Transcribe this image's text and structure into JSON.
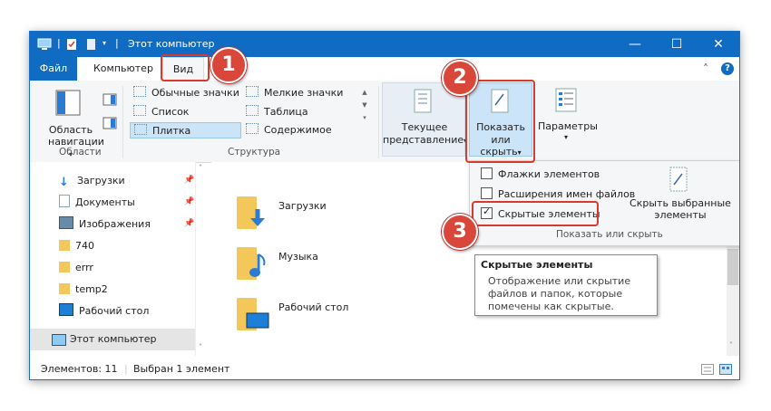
{
  "window": {
    "title": "Этот компьютер",
    "controls": {
      "minimize": "—",
      "maximize": "☐",
      "close": "✕"
    }
  },
  "menu": {
    "file": "Файл",
    "computer": "Компьютер",
    "view": "Вид",
    "collapse": "˄",
    "help": "?"
  },
  "ribbon": {
    "panes": {
      "nav_pane_label1": "Область",
      "nav_pane_label2": "навигации",
      "group": "Области"
    },
    "layout": {
      "group": "Структура",
      "items": [
        "Обычные значки",
        "Мелкие значки",
        "Список",
        "Таблица",
        "Плитка",
        "Содержимое"
      ]
    },
    "current_view": {
      "line1": "Текущее",
      "line2": "представление"
    },
    "show_hide": {
      "line1": "Показать",
      "line2": "или скрыть"
    },
    "options": "Параметры"
  },
  "dropdown": {
    "item_checkboxes": "Флажки элементов",
    "file_extensions": "Расширения имен файлов",
    "hidden_items": "Скрытые элементы",
    "hide_selected1": "Скрыть выбранные",
    "hide_selected2": "элементы",
    "group": "Показать или скрыть"
  },
  "tooltip": {
    "title": "Скрытые элементы",
    "line1": "Отображение или скрытие",
    "line2": "файлов и папок, которые",
    "line3": "помечены как скрытые."
  },
  "nav": {
    "items": [
      "Загрузки",
      "Документы",
      "Изображения",
      "740",
      "errr",
      "temp2",
      "Рабочий стол",
      "Этот компьютер"
    ]
  },
  "content": {
    "folders": [
      "Загрузки",
      "Музыка",
      "Рабочий стол"
    ]
  },
  "status": {
    "count": "Элементов: 11",
    "selected": "Выбран 1 элемент"
  },
  "badges": [
    "1",
    "2",
    "3"
  ],
  "colors": {
    "accent": "#0f6cc2",
    "highlight": "#d93a2e",
    "selection": "#cce4f7"
  }
}
